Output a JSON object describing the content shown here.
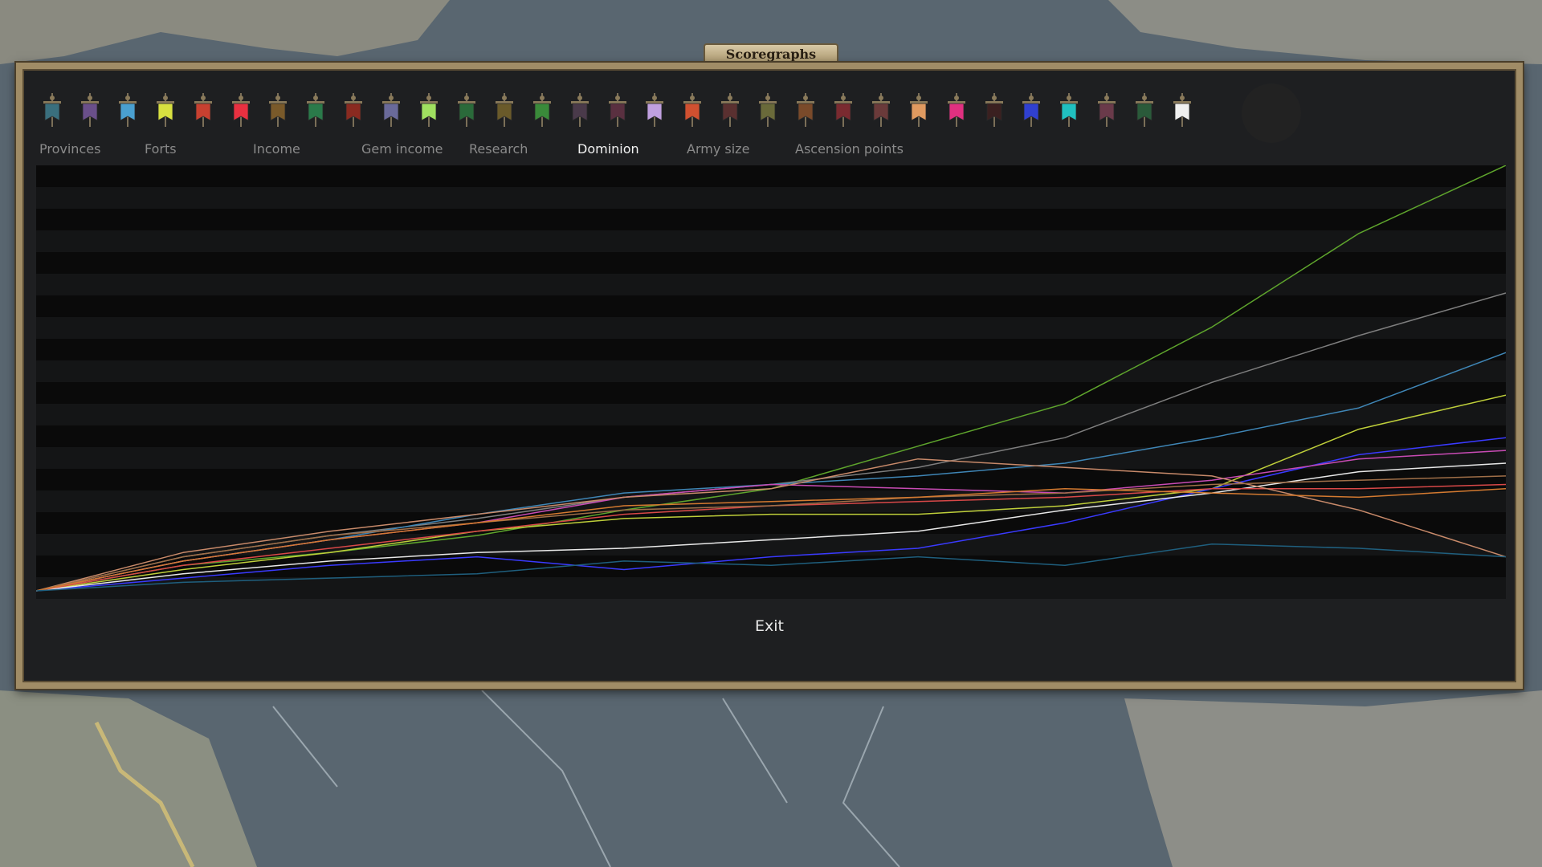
{
  "window": {
    "title": "Scoregraphs",
    "exit_label": "Exit"
  },
  "tabs": [
    {
      "label": "Provinces",
      "active": false
    },
    {
      "label": "Forts",
      "active": false
    },
    {
      "label": "Income",
      "active": false
    },
    {
      "label": "Gem income",
      "active": false
    },
    {
      "label": "Research",
      "active": false
    },
    {
      "label": "Dominion",
      "active": true
    },
    {
      "label": "Army size",
      "active": false
    },
    {
      "label": "Ascension points",
      "active": false
    }
  ],
  "nation_banners": [
    {
      "color": "#3a6f7e"
    },
    {
      "color": "#6a4f8a"
    },
    {
      "color": "#4aa0d0"
    },
    {
      "color": "#d8e040"
    },
    {
      "color": "#c84030"
    },
    {
      "color": "#e83040"
    },
    {
      "color": "#7a5a2a"
    },
    {
      "color": "#2a7a4a"
    },
    {
      "color": "#8a2a20"
    },
    {
      "color": "#6a6a9a"
    },
    {
      "color": "#a0e060"
    },
    {
      "color": "#2a6a3a"
    },
    {
      "color": "#6a5a2a"
    },
    {
      "color": "#3a8a3a"
    },
    {
      "color": "#4a3a4a"
    },
    {
      "color": "#5a3040"
    },
    {
      "color": "#c0a0e0"
    },
    {
      "color": "#d05030"
    },
    {
      "color": "#5a3030"
    },
    {
      "color": "#6a6a3a"
    },
    {
      "color": "#7a4a2a"
    },
    {
      "color": "#7a2a30"
    },
    {
      "color": "#6a3a3a"
    },
    {
      "color": "#e09a60"
    },
    {
      "color": "#e03080"
    },
    {
      "color": "#3a2020"
    },
    {
      "color": "#3040d0"
    },
    {
      "color": "#20c0c0"
    },
    {
      "color": "#6a3a4a"
    },
    {
      "color": "#2a5a3a"
    },
    {
      "color": "#f0f0f0"
    }
  ],
  "chart_data": {
    "type": "line",
    "x": [
      0,
      4,
      8,
      12,
      16,
      20,
      24,
      28,
      32,
      36,
      40
    ],
    "ylim": [
      0,
      100
    ],
    "series": [
      {
        "color": "#5ea42c",
        "values": [
          0,
          6,
          9,
          13,
          19,
          24,
          34,
          44,
          62,
          84,
          100
        ]
      },
      {
        "color": "#7e7e7e",
        "values": [
          0,
          8,
          13,
          17,
          22,
          25,
          29,
          36,
          49,
          60,
          70
        ]
      },
      {
        "color": "#3f86b6",
        "values": [
          0,
          7,
          12,
          18,
          23,
          25,
          27,
          30,
          36,
          43,
          56
        ]
      },
      {
        "color": "#bfcf3a",
        "values": [
          0,
          5,
          9,
          14,
          17,
          18,
          18,
          20,
          24,
          38,
          46
        ]
      },
      {
        "color": "#3a3aff",
        "values": [
          0,
          3,
          6,
          8,
          5,
          8,
          10,
          16,
          24,
          32,
          36
        ]
      },
      {
        "color": "#e8e8e8",
        "values": [
          0,
          4,
          7,
          9,
          10,
          12,
          14,
          19,
          23,
          28,
          30
        ]
      },
      {
        "color": "#d84848",
        "values": [
          0,
          6,
          10,
          14,
          18,
          20,
          21,
          22,
          24,
          24,
          25
        ]
      },
      {
        "color": "#c84bb4",
        "values": [
          0,
          7,
          12,
          16,
          22,
          25,
          24,
          23,
          26,
          31,
          33
        ]
      },
      {
        "color": "#c88a6a",
        "values": [
          0,
          9,
          14,
          18,
          22,
          24,
          31,
          29,
          27,
          19,
          8
        ]
      },
      {
        "color": "#a06f48",
        "values": [
          0,
          8,
          13,
          16,
          19,
          20,
          22,
          23,
          25,
          26,
          27
        ]
      },
      {
        "color": "#d47a30",
        "values": [
          0,
          7,
          12,
          16,
          20,
          21,
          22,
          24,
          23,
          22,
          24
        ]
      },
      {
        "color": "#1f5f7e",
        "values": [
          0,
          2,
          3,
          4,
          7,
          6,
          8,
          6,
          11,
          10,
          8
        ]
      }
    ]
  }
}
